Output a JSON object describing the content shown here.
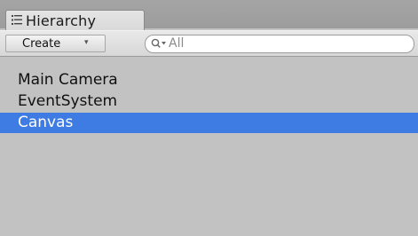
{
  "tab": {
    "label": "Hierarchy",
    "icon": "list-icon"
  },
  "toolbar": {
    "create_label": "Create",
    "create_caret": "▾",
    "search_value": "All",
    "search_icon": "search-icon"
  },
  "hierarchy": {
    "items": [
      {
        "label": "Main Camera",
        "selected": false
      },
      {
        "label": "EventSystem",
        "selected": false
      },
      {
        "label": "Canvas",
        "selected": true
      }
    ]
  },
  "colors": {
    "selection": "#3e7ce4",
    "panel_background": "#c2c2c2"
  }
}
